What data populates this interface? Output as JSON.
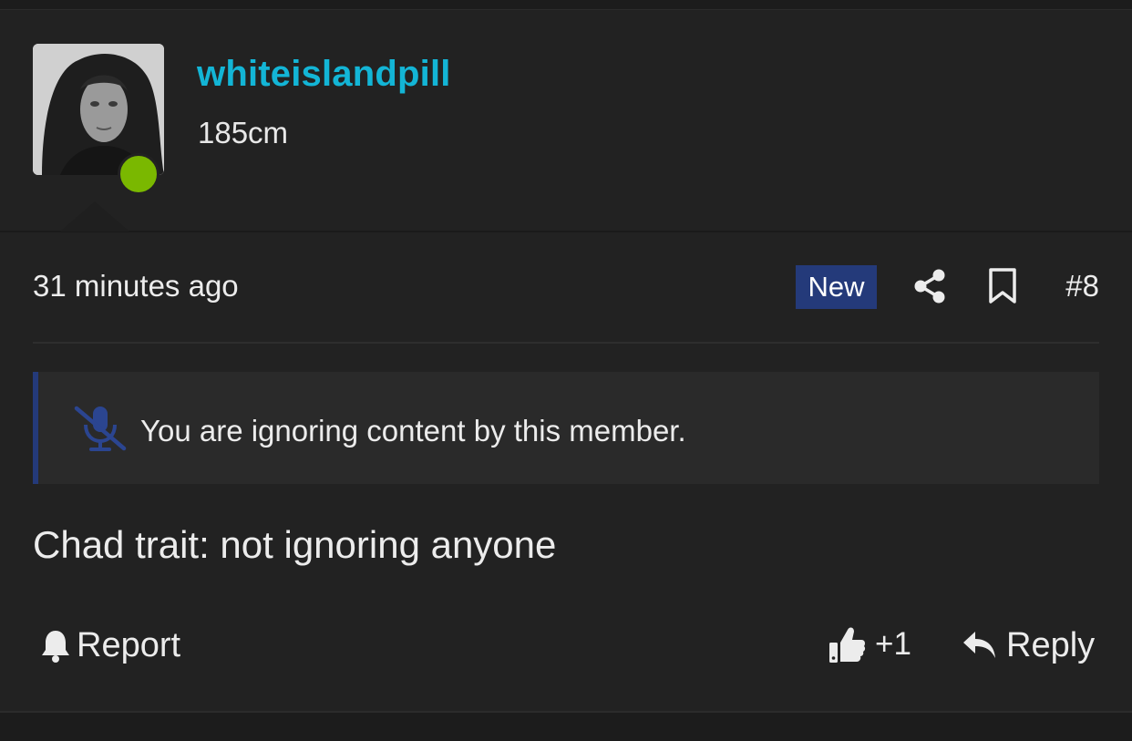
{
  "user": {
    "name": "whiteislandpill",
    "title": "185cm",
    "online": true,
    "avatar_icon": "avatar-photo"
  },
  "post": {
    "time": "31 minutes ago",
    "new_badge": "New",
    "number": "#8",
    "body": "Chad trait: not ignoring anyone"
  },
  "notice": {
    "text": "You are ignoring content by this member.",
    "icon": "mute-microphone-icon"
  },
  "actions": {
    "report_label": "Report",
    "like_label": "+1",
    "reply_label": "Reply"
  },
  "colors": {
    "username": "#13b5d6",
    "online": "#7ab800",
    "badge_bg": "#243a7a",
    "background": "#222222"
  }
}
